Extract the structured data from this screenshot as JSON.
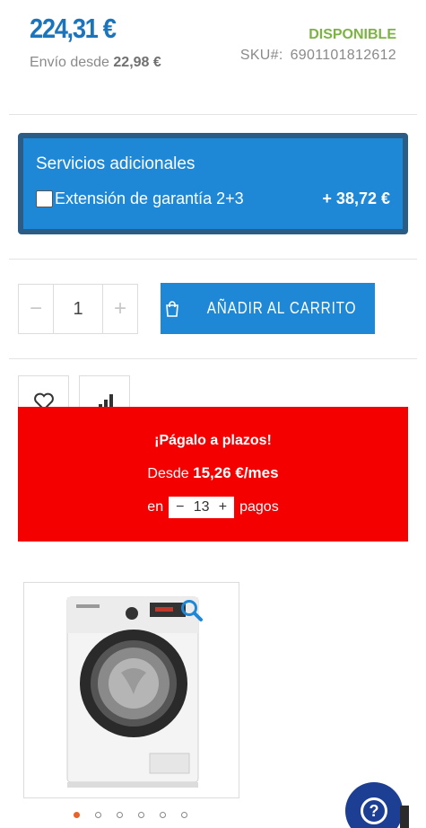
{
  "product": {
    "price": "224,31 €",
    "shipping_label": "Envío desde",
    "shipping_price": "22,98 €",
    "availability": "DISPONIBLE",
    "sku_label": "SKU#:",
    "sku_value": "6901101812612"
  },
  "services": {
    "title": "Servicios adicionales",
    "option_label": "Extensión de garantía 2+3",
    "option_price": "+ 38,72 €",
    "checked": false
  },
  "quantity": {
    "minus": "−",
    "value": "1",
    "plus": "+"
  },
  "cart": {
    "label": "AÑADIR AL CARRITO"
  },
  "financing": {
    "title": "¡Págalo a plazos!",
    "desde_label": "Desde",
    "amount": "15,26 €/mes",
    "en_label": "en",
    "minus": "−",
    "payments": "13",
    "plus": "+",
    "pagos_label": "pagos"
  },
  "gallery": {
    "image_count": 6,
    "active_index": 0,
    "dot_active_color": "#e8642c"
  },
  "icons": {
    "cart": "shopping-bag-icon",
    "wishlist": "heart-icon",
    "compare": "bar-chart-icon",
    "zoom": "magnifier-icon",
    "help": "question-mark-icon"
  },
  "colors": {
    "brand_blue": "#1b75bc",
    "button_blue": "#1e88d6",
    "available_green": "#7cb342",
    "financing_red": "#f50000",
    "help_navy": "#1c3f94"
  }
}
